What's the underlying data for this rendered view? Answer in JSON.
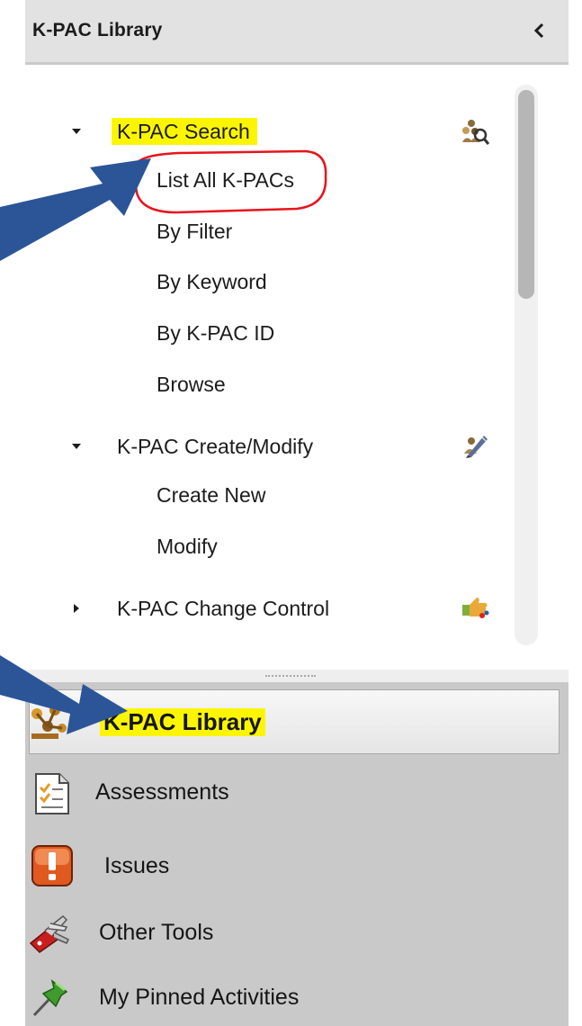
{
  "header": {
    "title": "K-PAC Library",
    "collapse_icon": "chevron-left-icon"
  },
  "tree": {
    "groups": [
      {
        "label": "K-PAC Search",
        "expanded": true,
        "highlighted": true,
        "icon": "search-people-icon",
        "items": [
          "List All K-PACs",
          "By Filter",
          "By Keyword",
          "By K-PAC ID",
          "Browse"
        ]
      },
      {
        "label": "K-PAC Create/Modify",
        "expanded": true,
        "icon": "edit-pencil-icon",
        "items": [
          "Create New",
          "Modify"
        ]
      },
      {
        "label": "K-PAC Change Control",
        "expanded": false,
        "icon": "hand-control-icon",
        "items": []
      }
    ]
  },
  "nav": {
    "items": [
      {
        "label": "K-PAC Library",
        "selected": true,
        "icon": "library-network-icon"
      },
      {
        "label": "Assessments",
        "selected": false,
        "icon": "checklist-icon"
      },
      {
        "label": "Issues",
        "selected": false,
        "icon": "warning-icon"
      },
      {
        "label": "Other Tools",
        "selected": false,
        "icon": "tools-icon"
      },
      {
        "label": "My Pinned Activities",
        "selected": false,
        "icon": "pin-icon"
      }
    ]
  },
  "colors": {
    "highlight": "#fbf600",
    "annotation_arrow": "#2b5597",
    "annotation_circle": "#e8141c",
    "header_bg": "#e2e2e2",
    "nav_bg": "#c9c9c9"
  }
}
